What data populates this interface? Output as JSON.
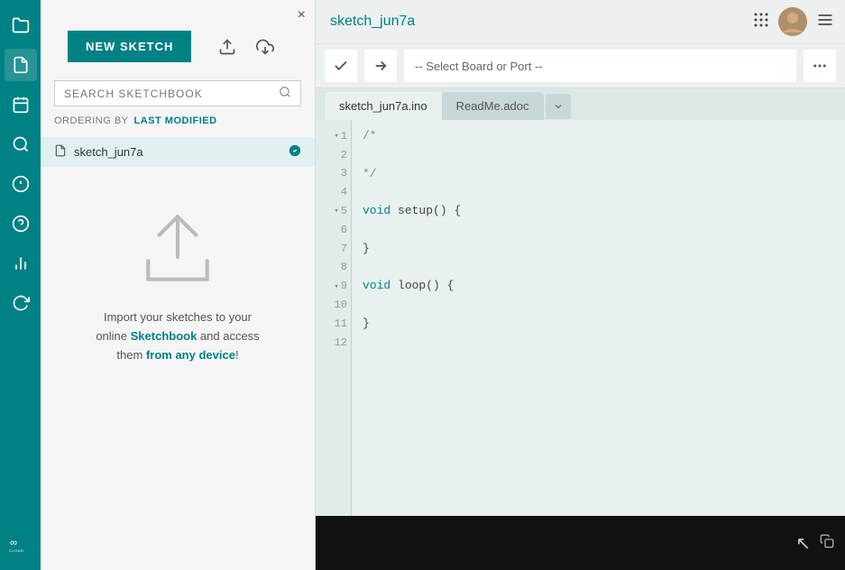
{
  "sidebar": {
    "items": [
      {
        "name": "folder-icon",
        "symbol": "📁",
        "label": "Files"
      },
      {
        "name": "document-icon",
        "symbol": "📄",
        "label": "Sketchbook"
      },
      {
        "name": "calendar-icon",
        "symbol": "📅",
        "label": "Examples"
      },
      {
        "name": "search-icon",
        "symbol": "🔍",
        "label": "Search"
      },
      {
        "name": "debug-icon",
        "symbol": "🔵",
        "label": "Debug"
      },
      {
        "name": "help-icon",
        "symbol": "❓",
        "label": "Help"
      },
      {
        "name": "chart-icon",
        "symbol": "📊",
        "label": "Serial Plotter"
      },
      {
        "name": "refresh-icon",
        "symbol": "🔄",
        "label": "Board Manager"
      }
    ],
    "logo_text": "CLOUD"
  },
  "sketchbook": {
    "close_label": "×",
    "new_sketch_label": "NEW SKETCH",
    "search_placeholder": "SEARCH SKETCHBOOK",
    "ordering_label": "ORDERING BY",
    "ordering_value": "LAST MODIFIED",
    "sketch_item": {
      "name": "sketch_jun7a",
      "has_badge": true
    },
    "upload_text_line1": "Import your sketches to your",
    "upload_text_line2_start": "online ",
    "upload_text_line2_highlight": "Sketchbook",
    "upload_text_line2_end": " and access",
    "upload_text_line3_start": "them ",
    "upload_text_line3_highlight2": "from any device",
    "upload_text_line3_end": "!"
  },
  "editor": {
    "title": "sketch_jun7a",
    "board_select_text": "-- Select Board or Port --",
    "tabs": [
      {
        "label": "sketch_jun7a.ino",
        "active": true
      },
      {
        "label": "ReadMe.adoc",
        "active": false
      }
    ],
    "code_lines": [
      {
        "num": 1,
        "has_fold": true,
        "content": "/*",
        "type": "comment"
      },
      {
        "num": 2,
        "has_fold": false,
        "content": "",
        "type": "normal"
      },
      {
        "num": 3,
        "has_fold": false,
        "content": "*/",
        "type": "comment"
      },
      {
        "num": 4,
        "has_fold": false,
        "content": "",
        "type": "normal"
      },
      {
        "num": 5,
        "has_fold": true,
        "content": "void setup() {",
        "type": "keyword"
      },
      {
        "num": 6,
        "has_fold": false,
        "content": "",
        "type": "normal"
      },
      {
        "num": 7,
        "has_fold": false,
        "content": "}",
        "type": "normal"
      },
      {
        "num": 8,
        "has_fold": false,
        "content": "",
        "type": "normal"
      },
      {
        "num": 9,
        "has_fold": true,
        "content": "void loop() {",
        "type": "keyword"
      },
      {
        "num": 10,
        "has_fold": false,
        "content": "",
        "type": "normal"
      },
      {
        "num": 11,
        "has_fold": false,
        "content": "}",
        "type": "normal"
      },
      {
        "num": 12,
        "has_fold": false,
        "content": "",
        "type": "normal"
      }
    ]
  },
  "colors": {
    "teal": "#008184",
    "bg_light": "#ecf0f0",
    "bg_code": "#e8f0f0"
  }
}
